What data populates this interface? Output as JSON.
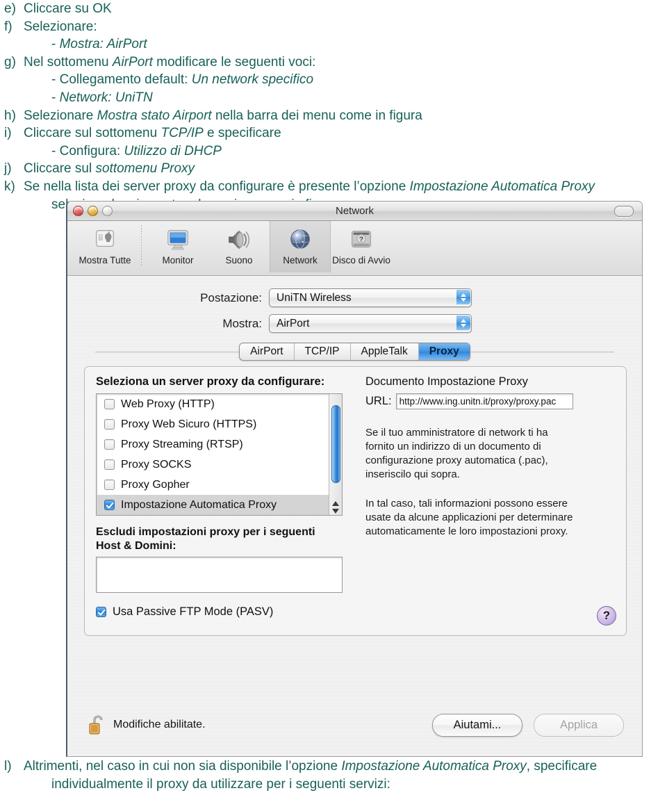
{
  "document": {
    "items": [
      {
        "marker": "e)",
        "lines": [
          {
            "parts": [
              {
                "t": "Cliccare su OK",
                "i": false
              }
            ]
          }
        ]
      },
      {
        "marker": "f)",
        "lines": [
          {
            "parts": [
              {
                "t": "Selezionare:",
                "i": false
              }
            ]
          },
          {
            "sub": true,
            "parts": [
              {
                "t": "- ",
                "i": false
              },
              {
                "t": "Mostra: AirPort",
                "i": true
              }
            ]
          }
        ]
      },
      {
        "marker": "g)",
        "lines": [
          {
            "parts": [
              {
                "t": "Nel sottomenu ",
                "i": false
              },
              {
                "t": "AirPort",
                "i": true
              },
              {
                "t": " modificare le seguenti voci:",
                "i": false
              }
            ]
          },
          {
            "sub": true,
            "parts": [
              {
                "t": "- Collegamento default: ",
                "i": false
              },
              {
                "t": "Un network specifico",
                "i": true
              }
            ]
          },
          {
            "sub": true,
            "parts": [
              {
                "t": "- ",
                "i": false
              },
              {
                "t": "Network: UniTN",
                "i": true
              }
            ]
          }
        ]
      },
      {
        "marker": "h)",
        "lines": [
          {
            "parts": [
              {
                "t": "Selezionare ",
                "i": false
              },
              {
                "t": "Mostra stato Airport",
                "i": true
              },
              {
                "t": " nella barra dei menu come in figura",
                "i": false
              }
            ]
          }
        ]
      },
      {
        "marker": "i)",
        "lines": [
          {
            "parts": [
              {
                "t": "Cliccare sul sottomenu ",
                "i": false
              },
              {
                "t": "TCP/IP",
                "i": true
              },
              {
                "t": " e specificare",
                "i": false
              }
            ]
          },
          {
            "sub": true,
            "parts": [
              {
                "t": "- Configura: ",
                "i": false
              },
              {
                "t": "Utilizzo di DHCP",
                "i": true
              }
            ]
          }
        ]
      },
      {
        "marker": "j)",
        "lines": [
          {
            "parts": [
              {
                "t": "Cliccare sul ",
                "i": false
              },
              {
                "t": "sottomenu Proxy",
                "i": true
              }
            ]
          }
        ]
      },
      {
        "marker": "k)",
        "lines": [
          {
            "parts": [
              {
                "t": "Se nella lista dei server proxy da configurare è presente l’opzione ",
                "i": false
              },
              {
                "t": "Impostazione Automatica Proxy",
                "i": true
              }
            ]
          },
          {
            "wrap": true,
            "parts": [
              {
                "t": "selezionarla e impostare la pagina come in figura:",
                "i": false
              }
            ]
          }
        ]
      }
    ],
    "footer": {
      "marker": "l)",
      "lines": [
        {
          "parts": [
            {
              "t": "Altrimenti, nel caso in cui non sia disponibile l’opzione ",
              "i": false
            },
            {
              "t": "Impostazione Automatica Proxy",
              "i": true
            },
            {
              "t": ", specificare",
              "i": false
            }
          ]
        },
        {
          "wrap": true,
          "parts": [
            {
              "t": "individualmente il proxy da utilizzare per i seguenti servizi:",
              "i": false
            }
          ]
        }
      ]
    },
    "text_color": "#186158"
  },
  "window": {
    "title": "Network",
    "traffic_lights": [
      "close-button",
      "minimize-button",
      "zoom-button"
    ],
    "toolbar_toggle": "toolbar-toggle-button",
    "toolbar": {
      "items": [
        {
          "label": "Mostra Tutte",
          "icon": "show-all-icon",
          "selected": false
        },
        {
          "separator": true
        },
        {
          "label": "Monitor",
          "icon": "display-icon",
          "selected": false
        },
        {
          "label": "Suono",
          "icon": "sound-icon",
          "selected": false
        },
        {
          "label": "Network",
          "icon": "network-globe-icon",
          "selected": true
        },
        {
          "label": "Disco di Avvio",
          "icon": "startup-disk-icon",
          "selected": false
        }
      ]
    },
    "popups": [
      {
        "label": "Postazione:",
        "value": "UniTN Wireless",
        "name": "location-popup"
      },
      {
        "label": "Mostra:",
        "value": "AirPort",
        "name": "show-popup"
      }
    ],
    "tabs": [
      {
        "label": "AirPort",
        "active": false
      },
      {
        "label": "TCP/IP",
        "active": false
      },
      {
        "label": "AppleTalk",
        "active": false
      },
      {
        "label": "Proxy",
        "active": true
      }
    ],
    "proxy_panel": {
      "list_title": "Seleziona un server proxy da configurare:",
      "proxy_services": [
        {
          "label": "Web Proxy (HTTP)",
          "checked": false
        },
        {
          "label": "Proxy Web Sicuro (HTTPS)",
          "checked": false
        },
        {
          "label": "Proxy Streaming (RTSP)",
          "checked": false
        },
        {
          "label": "Proxy SOCKS",
          "checked": false
        },
        {
          "label": "Proxy Gopher",
          "checked": false
        },
        {
          "label": "Impostazione Automatica Proxy",
          "checked": true
        }
      ],
      "exclude_title_line1": "Escludi impostazioni proxy per i seguenti",
      "exclude_title_line2": "Host & Domini:",
      "exclude_value": "",
      "pasv": {
        "label": "Usa Passive FTP Mode (PASV)",
        "checked": true
      },
      "doc_title": "Documento Impostazione Proxy",
      "url_label": "URL:",
      "url_value": "http://www.ing.unitn.it/proxy/proxy.pac",
      "help_paragraph_1": "Se il tuo amministratore di network ti ha fornito un indirizzo di un documento di configurazione proxy automatica (.pac), inseriscilo qui sopra.",
      "help_paragraph_2": "In tal caso, tali informazioni possono essere usate da alcune applicazioni per determinare automaticamente le loro impostazioni proxy.",
      "help_button": "?"
    },
    "bottom": {
      "lock_icon": "unlocked-padlock-icon",
      "lock_text": "Modifiche abilitate.",
      "help_button_label": "Aiutami...",
      "apply_button_label": "Applica",
      "apply_disabled": true
    }
  },
  "colors": {
    "doc_text": "#186158",
    "accent_blue": "#3e93e3",
    "window_bg": "#ededed"
  }
}
